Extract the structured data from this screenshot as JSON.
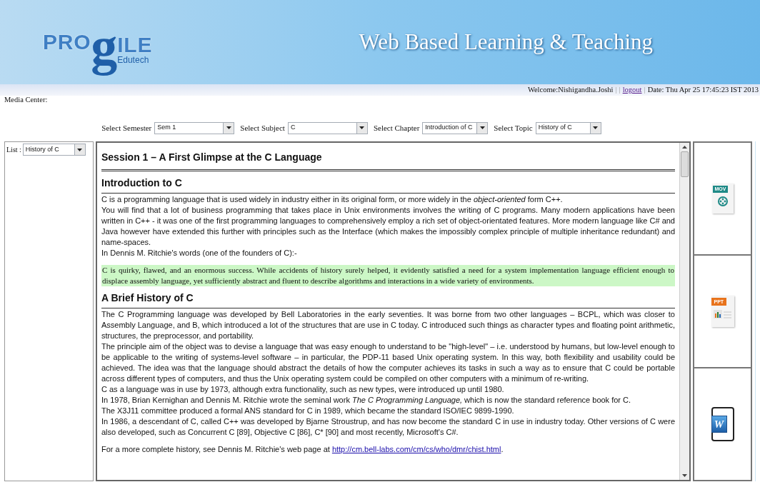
{
  "header": {
    "logo": {
      "parts": [
        "PRO",
        "g",
        "ILE"
      ],
      "subtitle": "Edutech"
    },
    "title": "Web Based Learning & Teaching"
  },
  "user_bar": {
    "welcome": "Welcome:Nishigandha.Joshi",
    "separators": [
      "|",
      "|",
      "|"
    ],
    "logout": "logout",
    "date": "Date: Thu Apr 25 17:45:23 IST 2013"
  },
  "media_center_label": "Media Center:",
  "selectors": [
    {
      "label": "Select Semester",
      "value": "Sem 1"
    },
    {
      "label": "Select Subject",
      "value": "C"
    },
    {
      "label": "Select Chapter",
      "value": "Introduction of C"
    },
    {
      "label": "Select Topic",
      "value": "History of C"
    }
  ],
  "list": {
    "label": "List :",
    "value": "History of C"
  },
  "document": {
    "title": "Session 1 – A First Glimpse at the C Language",
    "sections": [
      {
        "heading": "Introduction to C",
        "blocks": [
          {
            "kind": "paragraph",
            "text": "C is a programming language that is used widely in industry either in its original form, or more widely in the *object-oriented* form C++."
          },
          {
            "kind": "paragraph",
            "text": "You will find that a lot of business programming that takes place in Unix environments involves the writing of C programs. Many modern applications have been written in C++ - it was one of the first programming languages to comprehensively employ a rich set of object-orientated features. More modern language like C# and Java however have extended this further with principles such as the Interface (which makes the impossibly complex principle of multiple inheritance redundant) and name-spaces."
          },
          {
            "kind": "paragraph",
            "text": "In Dennis M. Ritchie's words (one of the founders of C):-"
          },
          {
            "kind": "quote",
            "text": "C is quirky, flawed, and an enormous success. While accidents of history surely helped, it evidently satisfied a need for a system implementation language efficient enough to displace assembly language, yet sufficiently abstract and fluent to describe algorithms and interactions in a wide variety of environments."
          }
        ]
      },
      {
        "heading": "A Brief History of C",
        "blocks": [
          {
            "kind": "paragraph",
            "text": "The C Programming language was developed by Bell Laboratories in the early seventies. It was borne from two other languages – BCPL, which was closer to Assembly Language, and B, which introduced a lot of the structures that are use in C today. C introduced such things as character types and floating point arithmetic, structures, the preprocessor, and portability."
          },
          {
            "kind": "paragraph",
            "text": "The principle aim of the object was to devise a language that was easy enough to understand to be \"high-level\" – i.e. understood by humans, but low-level enough to be applicable to the writing of systems-level software – in particular, the PDP-11 based Unix operating system. In this way, both flexibility and usability could be achieved. The idea was that the language should abstract the details of how the computer achieves its tasks in such a way as to ensure that C could be portable across different types of computers, and thus the Unix operating system could be compiled on other computers with a minimum of re-writing."
          },
          {
            "kind": "paragraph",
            "text": "C as a language was in use by 1973, although extra functionality, such as new types, were introduced up until 1980."
          },
          {
            "kind": "paragraph",
            "text": "In 1978, Brian Kernighan and Dennis M. Ritchie wrote the seminal work *The C Programming Language,* which is now the standard reference book for C."
          },
          {
            "kind": "paragraph",
            "text": "The X3J11 committee produced a formal ANS standard for C in 1989, which became the standard ISO/IEC 9899-1990."
          },
          {
            "kind": "paragraph",
            "text": "In 1986, a descendant of C, called C++ was developed by Bjarne Stroustrup, and has now become the standard C in use in industry today. Other versions of C were also developed, such as Concurrent C [89], Objective C [86], C* [90] and most recently, Microsoft's C#."
          },
          {
            "kind": "link",
            "text": "For a more complete history, see Dennis M. Ritchie's web page at ",
            "link": "http://cm.bell-labs.com/cm/cs/who/dmr/chist.html",
            "suffix": "."
          }
        ]
      }
    ]
  },
  "media": [
    {
      "kind": "video",
      "badge": "MOV"
    },
    {
      "kind": "slides",
      "badge": "PPT"
    },
    {
      "kind": "document",
      "badge": "W"
    }
  ]
}
